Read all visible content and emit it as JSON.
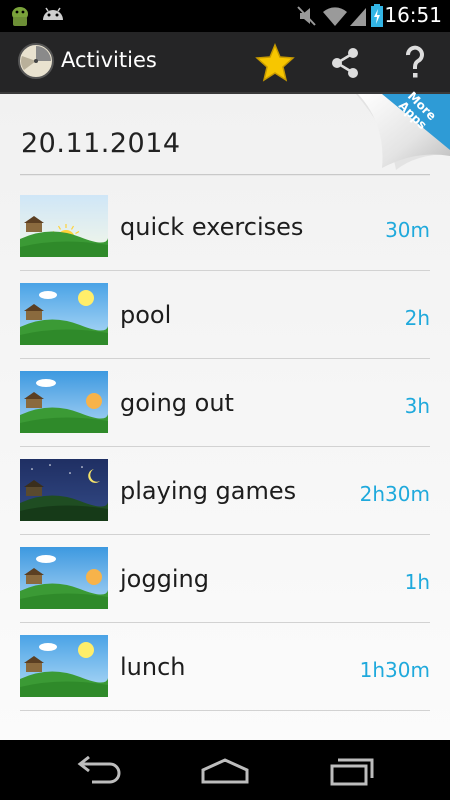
{
  "status_bar": {
    "time": "16:51"
  },
  "action_bar": {
    "title": "Activities"
  },
  "date": "20.11.2014",
  "more_apps": {
    "line1": "More",
    "line2": "Apps"
  },
  "activities": [
    {
      "name": "quick exercises",
      "duration": "30m",
      "scene": "sunrise"
    },
    {
      "name": "pool",
      "duration": "2h",
      "scene": "day"
    },
    {
      "name": "going out",
      "duration": "3h",
      "scene": "afternoon"
    },
    {
      "name": "playing games",
      "duration": "2h30m",
      "scene": "night"
    },
    {
      "name": "jogging",
      "duration": "1h",
      "scene": "afternoon"
    },
    {
      "name": "lunch",
      "duration": "1h30m",
      "scene": "day"
    }
  ],
  "colors": {
    "accent": "#1fa9dc",
    "star": "#f7c600",
    "action_bar": "#252526"
  },
  "icons": [
    "android-debug-icon",
    "android-icon",
    "mute-icon",
    "wifi-icon",
    "signal-icon",
    "battery-charging-icon",
    "app-logo-icon",
    "favorite-star-icon",
    "share-icon",
    "help-icon",
    "back-icon",
    "home-icon",
    "recents-icon"
  ]
}
